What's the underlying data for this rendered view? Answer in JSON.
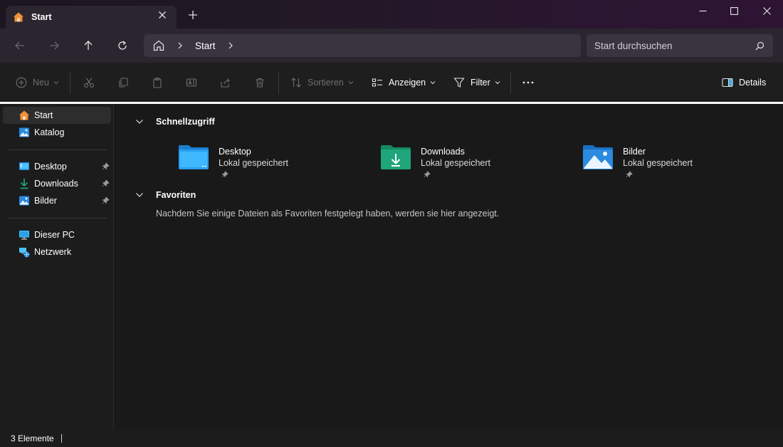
{
  "window": {
    "tab_title": "Start",
    "tab_close_icon": "close-icon",
    "new_tab_icon": "plus-icon",
    "controls": [
      "minimize-icon",
      "maximize-icon",
      "close-icon"
    ]
  },
  "address": {
    "back_icon": "arrow-left-icon",
    "forward_icon": "arrow-right-icon",
    "up_icon": "arrow-up-icon",
    "refresh_icon": "refresh-icon",
    "breadcrumb": "Start",
    "search_placeholder": "Start durchsuchen"
  },
  "toolbar": {
    "new_label": "Neu",
    "sort_label": "Sortieren",
    "view_label": "Anzeigen",
    "filter_label": "Filter",
    "details_label": "Details",
    "more_icon": "more-icon"
  },
  "sidebar": {
    "items": [
      {
        "label": "Start",
        "icon": "home-icon",
        "selected": true
      },
      {
        "label": "Katalog",
        "icon": "gallery-icon"
      },
      {
        "label": "Desktop",
        "icon": "desktop-folder-icon",
        "pinned": true
      },
      {
        "label": "Downloads",
        "icon": "download-icon",
        "pinned": true
      },
      {
        "label": "Bilder",
        "icon": "pictures-icon",
        "pinned": true
      },
      {
        "label": "Dieser PC",
        "icon": "monitor-icon"
      },
      {
        "label": "Netzwerk",
        "icon": "network-icon"
      }
    ]
  },
  "main": {
    "quick_access": {
      "title": "Schnellzugriff",
      "items": [
        {
          "name": "Desktop",
          "subtitle": "Lokal gespeichert",
          "icon": "desktop-folder-icon"
        },
        {
          "name": "Downloads",
          "subtitle": "Lokal gespeichert",
          "icon": "downloads-folder-icon"
        },
        {
          "name": "Bilder",
          "subtitle": "Lokal gespeichert",
          "icon": "pictures-folder-icon"
        }
      ]
    },
    "favorites": {
      "title": "Favoriten",
      "empty_message": "Nachdem Sie einige Dateien als Favoriten festgelegt haben, werden sie hier angezeigt."
    }
  },
  "status": {
    "count_text": "3 Elemente"
  },
  "colors": {
    "accent": "#4cc2ff",
    "home_orange": "#f0913a",
    "downloads_green": "#1fa67a",
    "folder_blue": "#2a8be0"
  }
}
